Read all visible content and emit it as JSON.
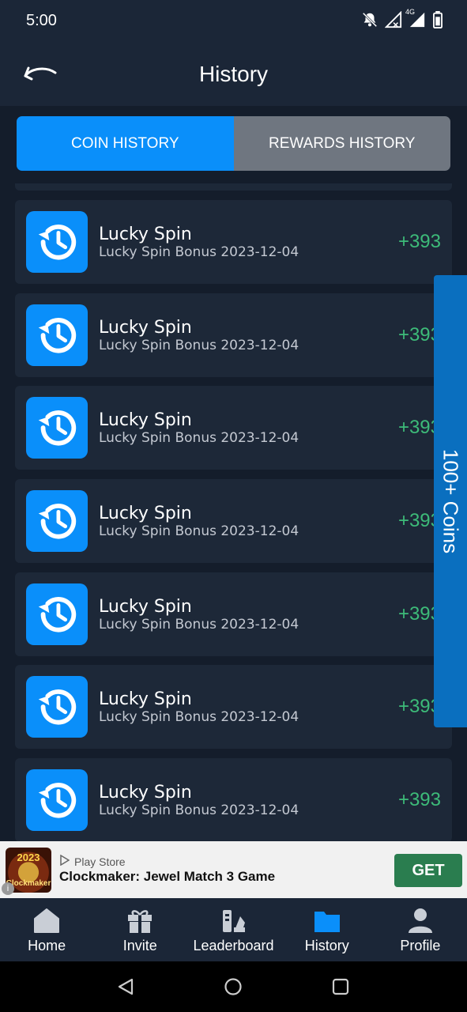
{
  "status_bar": {
    "time": "5:00",
    "icons": [
      "notifications-off-icon",
      "signal-off-icon",
      "4g-signal-icon",
      "battery-icon"
    ],
    "network_label": "4G"
  },
  "header": {
    "title": "History",
    "back_icon": "back-arrow-icon"
  },
  "tabs": [
    {
      "label": "COIN HISTORY",
      "active": true
    },
    {
      "label": "REWARDS HISTORY",
      "active": false
    }
  ],
  "history": [
    {
      "title": "Lucky Spin",
      "subtitle": "Lucky Spin Bonus",
      "date": "2023-12-04",
      "amount": "+393",
      "icon": "history-clock-icon"
    },
    {
      "title": "Lucky Spin",
      "subtitle": "Lucky Spin Bonus",
      "date": "2023-12-04",
      "amount": "+393",
      "icon": "history-clock-icon"
    },
    {
      "title": "Lucky Spin",
      "subtitle": "Lucky Spin Bonus",
      "date": "2023-12-04",
      "amount": "+393",
      "icon": "history-clock-icon"
    },
    {
      "title": "Lucky Spin",
      "subtitle": "Lucky Spin Bonus",
      "date": "2023-12-04",
      "amount": "+393",
      "icon": "history-clock-icon"
    },
    {
      "title": "Lucky Spin",
      "subtitle": "Lucky Spin Bonus",
      "date": "2023-12-04",
      "amount": "+393",
      "icon": "history-clock-icon"
    },
    {
      "title": "Lucky Spin",
      "subtitle": "Lucky Spin Bonus",
      "date": "2023-12-04",
      "amount": "+393",
      "icon": "history-clock-icon"
    },
    {
      "title": "Lucky Spin",
      "subtitle": "Lucky Spin Bonus",
      "date": "2023-12-04",
      "amount": "+393",
      "icon": "history-clock-icon"
    }
  ],
  "side_tab": {
    "label": "100+ Coins"
  },
  "ad": {
    "store": "Play Store",
    "title": "Clockmaker: Jewel Match 3 Game",
    "button": "GET",
    "logo_year": "2023",
    "logo_name": "Clockmaker"
  },
  "bottom_nav": [
    {
      "label": "Home",
      "icon": "home-icon",
      "active": false
    },
    {
      "label": "Invite",
      "icon": "gift-icon",
      "active": false
    },
    {
      "label": "Leaderboard",
      "icon": "leaderboard-icon",
      "active": false
    },
    {
      "label": "History",
      "icon": "folder-icon",
      "active": true
    },
    {
      "label": "Profile",
      "icon": "person-icon",
      "active": false
    }
  ],
  "system_nav": [
    "back-triangle-icon",
    "home-circle-icon",
    "recents-square-icon"
  ],
  "colors": {
    "background": "#1b2637",
    "content_bg": "#141d2b",
    "card_bg": "#1d2838",
    "accent": "#0a8ffa",
    "amount_green": "#3dbb79",
    "inactive_tab": "#6f7680",
    "ad_button": "#2a7d4f"
  }
}
